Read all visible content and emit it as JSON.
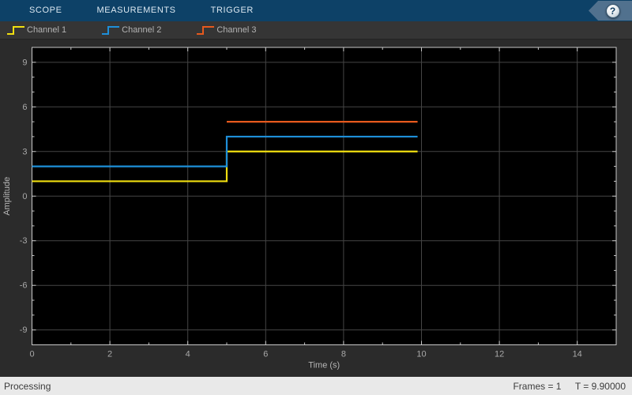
{
  "header": {
    "tabs": [
      {
        "label": "SCOPE"
      },
      {
        "label": "MEASUREMENTS"
      },
      {
        "label": "TRIGGER"
      }
    ],
    "help_label": "?"
  },
  "status": {
    "left": "Processing",
    "frames": "Frames = 1",
    "time": "T = 9.90000"
  },
  "colors": {
    "toolbar_bg": "#0d4167",
    "plot_bg": "#000000",
    "surround_bg": "#2b2b2b",
    "grid": "#454545",
    "axis_border": "#c8c8c8",
    "tick_label": "#a8a8a8",
    "axis_label": "#b6b6b6",
    "channel1": "#f0de10",
    "channel2": "#1e8fd9",
    "channel3": "#e6591d"
  },
  "chart_data": {
    "type": "line",
    "title": "",
    "xlabel": "Time (s)",
    "ylabel": "Amplitude",
    "xlim": [
      0,
      15
    ],
    "ylim": [
      -10,
      10
    ],
    "x_major_ticks": [
      0,
      2,
      4,
      6,
      8,
      10,
      12,
      14
    ],
    "y_major_ticks": [
      -9,
      -6,
      -3,
      0,
      3,
      6,
      9
    ],
    "minor_tick_step": 1,
    "grid": true,
    "legend_position": "top-left-bar",
    "series": [
      {
        "name": "Channel 1",
        "color": "#f0de10",
        "x": [
          0,
          5,
          5,
          9.9
        ],
        "y": [
          1,
          1,
          3,
          3
        ]
      },
      {
        "name": "Channel 2",
        "color": "#1e8fd9",
        "x": [
          0,
          5,
          5,
          9.9
        ],
        "y": [
          2,
          2,
          4,
          4
        ]
      },
      {
        "name": "Channel 3",
        "color": "#e6591d",
        "x": [
          5,
          9.9
        ],
        "y": [
          5,
          5
        ]
      }
    ]
  }
}
